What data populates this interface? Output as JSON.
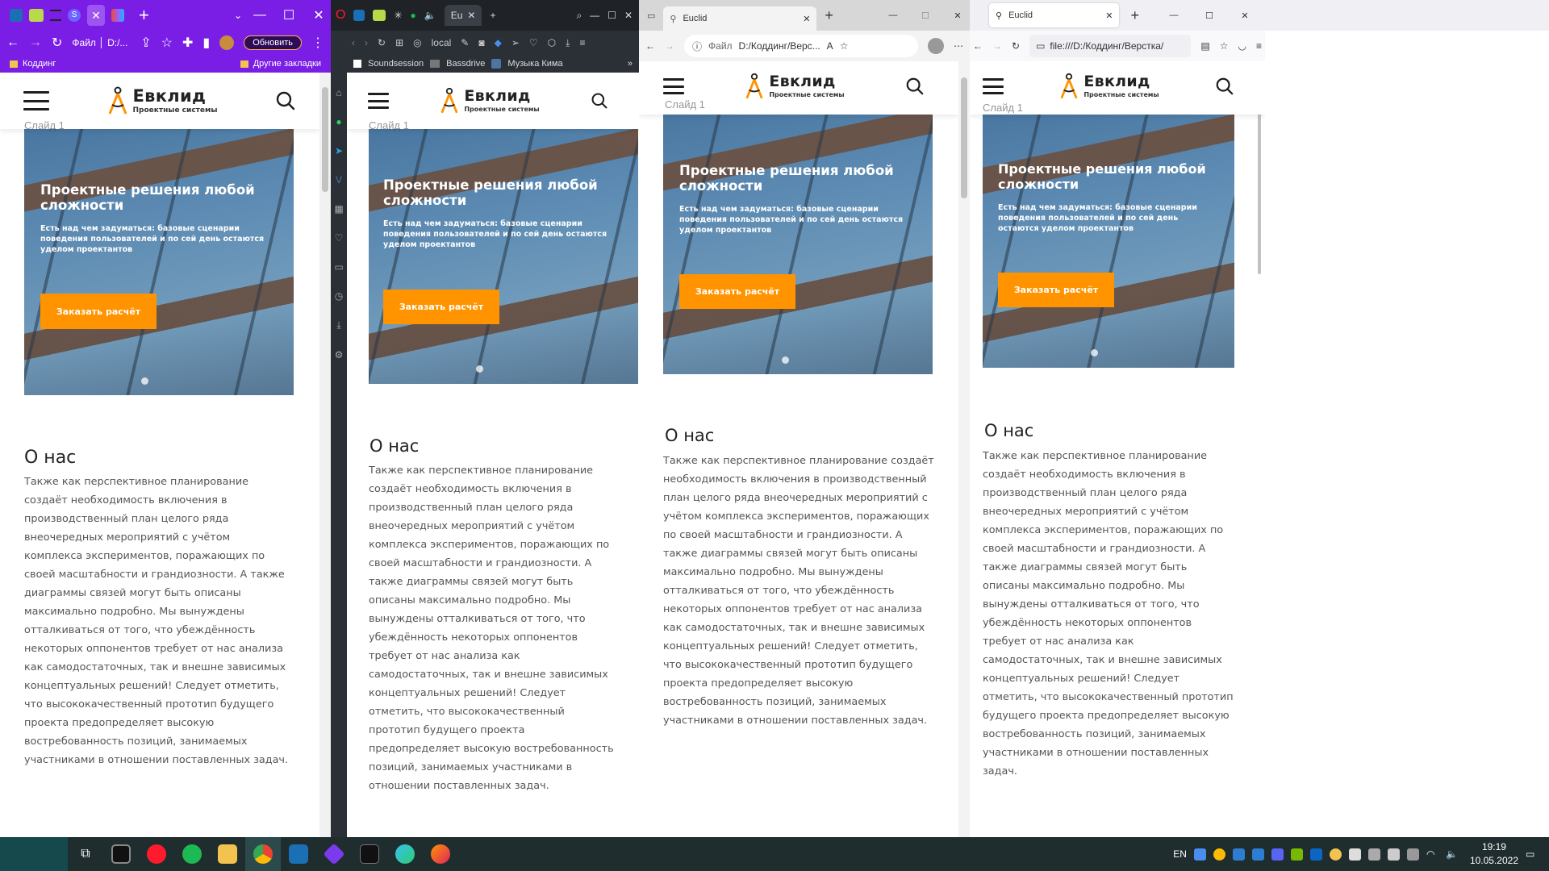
{
  "windows": [
    {
      "browser": "chrome",
      "address": "Файл │ D:/...",
      "update_button": "Обновить",
      "bookmarks": [
        "Коддинг",
        "Другие закладки"
      ]
    },
    {
      "browser": "opera",
      "tab_title": "Eu",
      "address": "local",
      "bookmarks": [
        "Soundsession",
        "Bassdrive",
        "Музыка Кима"
      ]
    },
    {
      "browser": "edge",
      "tab_title": "Euclid",
      "address": "D:/Коддинг/Верс...",
      "file_label": "Файл"
    },
    {
      "browser": "firefox",
      "tab_title": "Euclid",
      "address": "file:///D:/Коддинг/Верстка/"
    }
  ],
  "site": {
    "logo_name": "Евклид",
    "logo_sub": "Проектные системы",
    "slide_label": "Слайд 1",
    "hero_title": "Проектные решения любой сложности",
    "hero_text": "Есть над чем задуматься: базовые сценарии поведения пользователей и по сей день остаются уделом проектантов",
    "hero_button": "Заказать расчёт",
    "about_title": "О нас",
    "about_text": "Также как перспективное планирование создаёт необходимость включения в производственный план целого ряда внеочередных мероприятий с учётом комплекса экспериментов, поражающих по своей масштабности и грандиозности. А также диаграммы связей могут быть описаны максимально подробно. Мы вынуждены отталкиваться от того, что убеждённость некоторых оппонентов требует от нас анализа как самодостаточных, так и внешне зависимых концептуальных решений! Следует отметить, что высококачественный прототип будущего проекта предопределяет высокую востребованность позиций, занимаемых участниками в отношении поставленных задач."
  },
  "colors": {
    "accent": "#ff9300",
    "chrome_bar": "#7a1ee6",
    "opera_bar": "#2b2f36",
    "taskbar": "#1f2d2e"
  },
  "taskbar": {
    "lang": "EN",
    "time": "19:19",
    "date": "10.05.2022"
  }
}
